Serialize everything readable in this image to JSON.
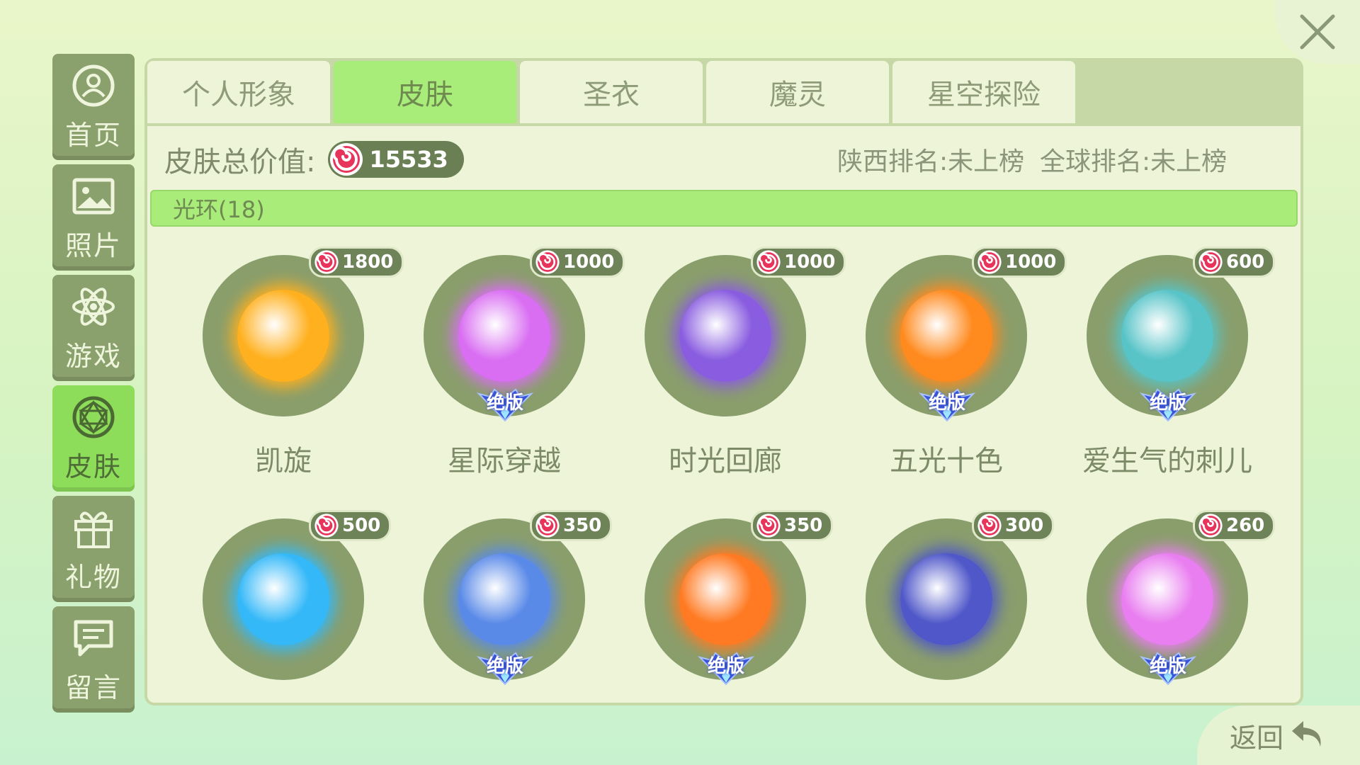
{
  "sidebar": {
    "items": [
      {
        "label": "首页",
        "icon": "home-icon",
        "active": false
      },
      {
        "label": "照片",
        "icon": "photo-icon",
        "active": false
      },
      {
        "label": "游戏",
        "icon": "atom-icon",
        "active": false
      },
      {
        "label": "皮肤",
        "icon": "gem-icon",
        "active": true
      },
      {
        "label": "礼物",
        "icon": "gift-icon",
        "active": false
      },
      {
        "label": "留言",
        "icon": "message-icon",
        "active": false
      }
    ]
  },
  "tabs": [
    {
      "label": "个人形象",
      "active": false
    },
    {
      "label": "皮肤",
      "active": true
    },
    {
      "label": "圣衣",
      "active": false
    },
    {
      "label": "魔灵",
      "active": false
    },
    {
      "label": "星空探险",
      "active": false
    }
  ],
  "summary": {
    "total_label": "皮肤总价值:",
    "total_value": "15533",
    "province_rank": "陕西排名:未上榜",
    "global_rank": "全球排名:未上榜"
  },
  "category": {
    "label": "光环(18)"
  },
  "items": [
    {
      "name": "凯旋",
      "price": "1800",
      "limited": false,
      "orb_color": "#ffb01e"
    },
    {
      "name": "星际穿越",
      "price": "1000",
      "limited": true,
      "orb_color": "#d96ef2"
    },
    {
      "name": "时光回廊",
      "price": "1000",
      "limited": false,
      "orb_color": "#8a5de0"
    },
    {
      "name": "五光十色",
      "price": "1000",
      "limited": true,
      "orb_color": "#ff8a1e"
    },
    {
      "name": "爱生气的刺儿",
      "price": "600",
      "limited": true,
      "orb_color": "#58c4c8"
    },
    {
      "name": "",
      "price": "500",
      "limited": false,
      "orb_color": "#34b8f8"
    },
    {
      "name": "",
      "price": "350",
      "limited": true,
      "orb_color": "#5a8ae8"
    },
    {
      "name": "",
      "price": "350",
      "limited": true,
      "orb_color": "#ff7a22"
    },
    {
      "name": "",
      "price": "300",
      "limited": false,
      "orb_color": "#4f57c9"
    },
    {
      "name": "",
      "price": "260",
      "limited": true,
      "orb_color": "#e97ef0"
    }
  ],
  "badge_label": "绝版",
  "back_label": "返回",
  "colors": {
    "accent_green": "#a8ec7a",
    "sidebar": "#8aa16d",
    "candy_red": "#e8335a"
  }
}
